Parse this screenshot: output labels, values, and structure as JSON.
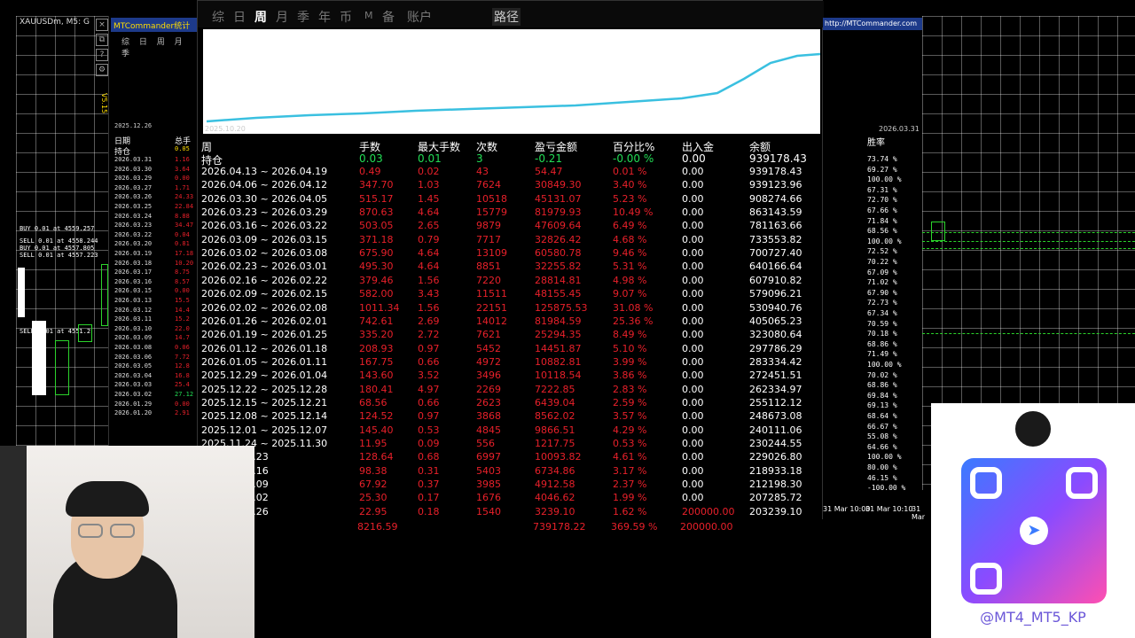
{
  "left_chart": {
    "title": "XAUUSDm, M5: G",
    "orders": [
      "BUY 0.01 at 4559.257",
      "SELL 0.01 at 4558.244",
      "BUY 0.01 at 4557.805",
      "SELL 0.01 at 4557.223",
      "SELL 0.01 at 4551.2"
    ]
  },
  "mini_panel": {
    "header": "MTCommander统计",
    "tabs": "综 日 周 月 季",
    "version": "V5.15",
    "date_label": "2025.12.26",
    "col_date": "日期",
    "col_total": "总手",
    "holding": "持仓",
    "holding_val": "0.05",
    "rows": [
      {
        "d": "2026.03.31",
        "v": "1.16"
      },
      {
        "d": "2026.03.30",
        "v": "3.64"
      },
      {
        "d": "2026.03.29",
        "v": "0.00"
      },
      {
        "d": "2026.03.27",
        "v": "1.71"
      },
      {
        "d": "2026.03.26",
        "v": "24.33"
      },
      {
        "d": "2026.03.25",
        "v": "22.84"
      },
      {
        "d": "2026.03.24",
        "v": "8.88"
      },
      {
        "d": "2026.03.23",
        "v": "34.47"
      },
      {
        "d": "2026.03.22",
        "v": "0.04"
      },
      {
        "d": "2026.03.20",
        "v": "0.81"
      },
      {
        "d": "2026.03.19",
        "v": "17.18"
      },
      {
        "d": "2026.03.18",
        "v": "10.20"
      },
      {
        "d": "2026.03.17",
        "v": "8.75"
      },
      {
        "d": "2026.03.16",
        "v": "8.57"
      },
      {
        "d": "2026.03.15",
        "v": "0.00"
      },
      {
        "d": "2026.03.13",
        "v": "15.5"
      },
      {
        "d": "2026.03.12",
        "v": "14.4"
      },
      {
        "d": "2026.03.11",
        "v": "15.2"
      },
      {
        "d": "2026.03.10",
        "v": "22.0"
      },
      {
        "d": "2026.03.09",
        "v": "14.7"
      },
      {
        "d": "2026.03.08",
        "v": "0.06"
      },
      {
        "d": "2026.03.06",
        "v": "7.72"
      },
      {
        "d": "2026.03.05",
        "v": "12.8"
      },
      {
        "d": "2026.03.04",
        "v": "16.8"
      },
      {
        "d": "2026.03.03",
        "v": "25.4"
      },
      {
        "d": "2026.03.02",
        "v": "27.12"
      },
      {
        "d": "2026.01.29",
        "v": "0.00"
      },
      {
        "d": "2026.01.20",
        "v": "2.91"
      }
    ]
  },
  "main": {
    "nav": [
      "综",
      "日",
      "周",
      "月",
      "季",
      "年",
      "币",
      "M",
      "备",
      "账户",
      "路径"
    ],
    "active_nav": "周",
    "url": "http://MTCommander.com",
    "date_start": "2025.10.20",
    "date_end": "2026.03.31",
    "headers": {
      "week": "周",
      "lot": "手数",
      "max": "最大手数",
      "cnt": "次数",
      "pnl": "盈亏金额",
      "pct": "百分比%",
      "io": "出入金",
      "bal": "余额"
    },
    "holding": {
      "week": "持仓",
      "lot": "0.03",
      "max": "0.01",
      "cnt": "3",
      "pnl": "-0.21",
      "pct": "-0.00 %",
      "io": "0.00",
      "bal": "939178.43"
    },
    "rows": [
      {
        "week": "2026.04.13 ~ 2026.04.19",
        "lot": "0.49",
        "max": "0.02",
        "cnt": "43",
        "pnl": "54.47",
        "pct": "0.01 %",
        "io": "0.00",
        "bal": "939178.43"
      },
      {
        "week": "2026.04.06 ~ 2026.04.12",
        "lot": "347.70",
        "max": "1.03",
        "cnt": "7624",
        "pnl": "30849.30",
        "pct": "3.40 %",
        "io": "0.00",
        "bal": "939123.96"
      },
      {
        "week": "2026.03.30 ~ 2026.04.05",
        "lot": "515.17",
        "max": "1.45",
        "cnt": "10518",
        "pnl": "45131.07",
        "pct": "5.23 %",
        "io": "0.00",
        "bal": "908274.66"
      },
      {
        "week": "2026.03.23 ~ 2026.03.29",
        "lot": "870.63",
        "max": "4.64",
        "cnt": "15779",
        "pnl": "81979.93",
        "pct": "10.49 %",
        "io": "0.00",
        "bal": "863143.59"
      },
      {
        "week": "2026.03.16 ~ 2026.03.22",
        "lot": "503.05",
        "max": "2.65",
        "cnt": "9879",
        "pnl": "47609.64",
        "pct": "6.49 %",
        "io": "0.00",
        "bal": "781163.66"
      },
      {
        "week": "2026.03.09 ~ 2026.03.15",
        "lot": "371.18",
        "max": "0.79",
        "cnt": "7717",
        "pnl": "32826.42",
        "pct": "4.68 %",
        "io": "0.00",
        "bal": "733553.82"
      },
      {
        "week": "2026.03.02 ~ 2026.03.08",
        "lot": "675.90",
        "max": "4.64",
        "cnt": "13109",
        "pnl": "60580.78",
        "pct": "9.46 %",
        "io": "0.00",
        "bal": "700727.40"
      },
      {
        "week": "2026.02.23 ~ 2026.03.01",
        "lot": "495.30",
        "max": "4.64",
        "cnt": "8851",
        "pnl": "32255.82",
        "pct": "5.31 %",
        "io": "0.00",
        "bal": "640166.64"
      },
      {
        "week": "2026.02.16 ~ 2026.02.22",
        "lot": "379.46",
        "max": "1.56",
        "cnt": "7220",
        "pnl": "28814.81",
        "pct": "4.98 %",
        "io": "0.00",
        "bal": "607910.82"
      },
      {
        "week": "2026.02.09 ~ 2026.02.15",
        "lot": "582.00",
        "max": "3.43",
        "cnt": "11511",
        "pnl": "48155.45",
        "pct": "9.07 %",
        "io": "0.00",
        "bal": "579096.21"
      },
      {
        "week": "2026.02.02 ~ 2026.02.08",
        "lot": "1011.34",
        "max": "1.56",
        "cnt": "22151",
        "pnl": "125875.53",
        "pct": "31.08 %",
        "io": "0.00",
        "bal": "530940.76"
      },
      {
        "week": "2026.01.26 ~ 2026.02.01",
        "lot": "742.61",
        "max": "2.69",
        "cnt": "14012",
        "pnl": "81984.59",
        "pct": "25.36 %",
        "io": "0.00",
        "bal": "405065.23"
      },
      {
        "week": "2026.01.19 ~ 2026.01.25",
        "lot": "335.20",
        "max": "2.72",
        "cnt": "7621",
        "pnl": "25294.35",
        "pct": "8.49 %",
        "io": "0.00",
        "bal": "323080.64"
      },
      {
        "week": "2026.01.12 ~ 2026.01.18",
        "lot": "208.93",
        "max": "0.97",
        "cnt": "5452",
        "pnl": "14451.87",
        "pct": "5.10 %",
        "io": "0.00",
        "bal": "297786.29"
      },
      {
        "week": "2026.01.05 ~ 2026.01.11",
        "lot": "167.75",
        "max": "0.66",
        "cnt": "4972",
        "pnl": "10882.81",
        "pct": "3.99 %",
        "io": "0.00",
        "bal": "283334.42"
      },
      {
        "week": "2025.12.29 ~ 2026.01.04",
        "lot": "143.60",
        "max": "3.52",
        "cnt": "3496",
        "pnl": "10118.54",
        "pct": "3.86 %",
        "io": "0.00",
        "bal": "272451.51"
      },
      {
        "week": "2025.12.22 ~ 2025.12.28",
        "lot": "180.41",
        "max": "4.97",
        "cnt": "2269",
        "pnl": "7222.85",
        "pct": "2.83 %",
        "io": "0.00",
        "bal": "262334.97"
      },
      {
        "week": "2025.12.15 ~ 2025.12.21",
        "lot": "68.56",
        "max": "0.66",
        "cnt": "2623",
        "pnl": "6439.04",
        "pct": "2.59 %",
        "io": "0.00",
        "bal": "255112.12"
      },
      {
        "week": "2025.12.08 ~ 2025.12.14",
        "lot": "124.52",
        "max": "0.97",
        "cnt": "3868",
        "pnl": "8562.02",
        "pct": "3.57 %",
        "io": "0.00",
        "bal": "248673.08"
      },
      {
        "week": "2025.12.01 ~ 2025.12.07",
        "lot": "145.40",
        "max": "0.53",
        "cnt": "4845",
        "pnl": "9866.51",
        "pct": "4.29 %",
        "io": "0.00",
        "bal": "240111.06"
      },
      {
        "week": "2025.11.24 ~ 2025.11.30",
        "lot": "11.95",
        "max": "0.09",
        "cnt": "556",
        "pnl": "1217.75",
        "pct": "0.53 %",
        "io": "0.00",
        "bal": "230244.55"
      },
      {
        "week": "~ 2025.11.23",
        "lot": "128.64",
        "max": "0.68",
        "cnt": "6997",
        "pnl": "10093.82",
        "pct": "4.61 %",
        "io": "0.00",
        "bal": "229026.80"
      },
      {
        "week": "~ 2025.11.16",
        "lot": "98.38",
        "max": "0.31",
        "cnt": "5403",
        "pnl": "6734.86",
        "pct": "3.17 %",
        "io": "0.00",
        "bal": "218933.18"
      },
      {
        "week": "~ 2025.11.09",
        "lot": "67.92",
        "max": "0.37",
        "cnt": "3985",
        "pnl": "4912.58",
        "pct": "2.37 %",
        "io": "0.00",
        "bal": "212198.30"
      },
      {
        "week": "~ 2025.11.02",
        "lot": "25.30",
        "max": "0.17",
        "cnt": "1676",
        "pnl": "4046.62",
        "pct": "1.99 %",
        "io": "0.00",
        "bal": "207285.72"
      },
      {
        "week": "~ 2025.10.26",
        "lot": "22.95",
        "max": "0.18",
        "cnt": "1540",
        "pnl": "3239.10",
        "pct": "1.62 %",
        "io": "200000.00",
        "bal": "203239.10"
      }
    ],
    "total": {
      "lot": "8216.59",
      "pnl": "739178.22",
      "pct": "369.59 %",
      "io": "200000.00"
    }
  },
  "rate_col": {
    "header": "胜率",
    "values": [
      "73.74 %",
      "69.27 %",
      "100.00 %",
      "67.31 %",
      "72.70 %",
      "67.66 %",
      "71.84 %",
      "68.56 %",
      "100.00 %",
      "72.52 %",
      "70.22 %",
      "67.09 %",
      "71.02 %",
      "67.90 %",
      "72.73 %",
      "67.34 %",
      "70.59 %",
      "70.18 %",
      "68.86 %",
      "71.49 %",
      "100.00 %",
      "70.02 %",
      "68.86 %",
      "69.84 %",
      "69.13 %",
      "68.64 %",
      "66.67 %",
      "55.08 %",
      "64.66 %",
      "100.00 %",
      "80.00 %",
      "46.15 %",
      "-100.00 %"
    ]
  },
  "time_axis": [
    "31 Mar 10:00",
    "31 Mar 10:10",
    "31 Mar"
  ],
  "qr": {
    "handle": "@MT4_MT5_KP"
  },
  "colors": {
    "accent": "#3ac0e0",
    "red": "#e8202a",
    "green": "#22dd55",
    "yellow": "#ffdd00"
  }
}
